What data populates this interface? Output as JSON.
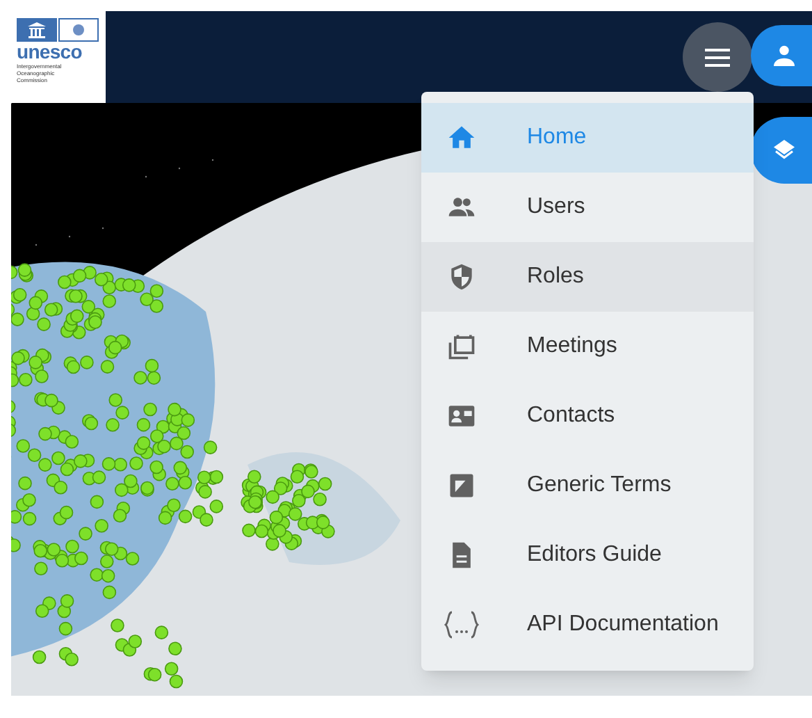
{
  "logo": {
    "wordmark": "unesco",
    "caption": [
      "Intergovernmental",
      "Oceanographic",
      "Commission"
    ]
  },
  "menu": {
    "items": [
      {
        "kind": "home",
        "label": "Home",
        "selected": true,
        "highlighted": false
      },
      {
        "kind": "users",
        "label": "Users",
        "selected": false,
        "highlighted": false
      },
      {
        "kind": "roles",
        "label": "Roles",
        "selected": false,
        "highlighted": true
      },
      {
        "kind": "meetings",
        "label": "Meetings",
        "selected": false,
        "highlighted": false
      },
      {
        "kind": "contacts",
        "label": "Contacts",
        "selected": false,
        "highlighted": false
      },
      {
        "kind": "terms",
        "label": "Generic Terms",
        "selected": false,
        "highlighted": false
      },
      {
        "kind": "guide",
        "label": "Editors Guide",
        "selected": false,
        "highlighted": false
      },
      {
        "kind": "api",
        "label": "API Documentation",
        "selected": false,
        "highlighted": false
      }
    ]
  }
}
